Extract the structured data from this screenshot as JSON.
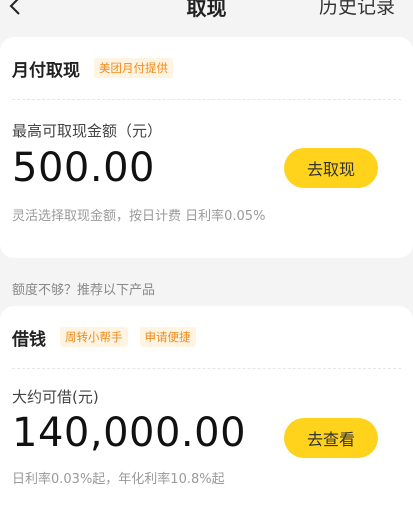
{
  "nav": {
    "title": "取现",
    "right_link": "历史记录"
  },
  "card1": {
    "title": "月付取现",
    "tag": "美团月付提供",
    "amount_label": "最高可取现金额（元）",
    "amount": "500.00",
    "button": "去取现",
    "note": "灵活选择取现金额，按日计费 日利率0.05%"
  },
  "recommend_hint": "额度不够？推荐以下产品",
  "card2": {
    "title": "借钱",
    "tags": [
      "周转小帮手",
      "申请便捷"
    ],
    "amount_label": "大约可借(元)",
    "amount": "140,000.00",
    "button": "去查看",
    "note": "日利率0.03%起，年化利率10.8%起"
  },
  "colors": {
    "accent": "#ffd21c",
    "tag_text": "#f08a1c",
    "tag_bg": "#fff4e2"
  }
}
